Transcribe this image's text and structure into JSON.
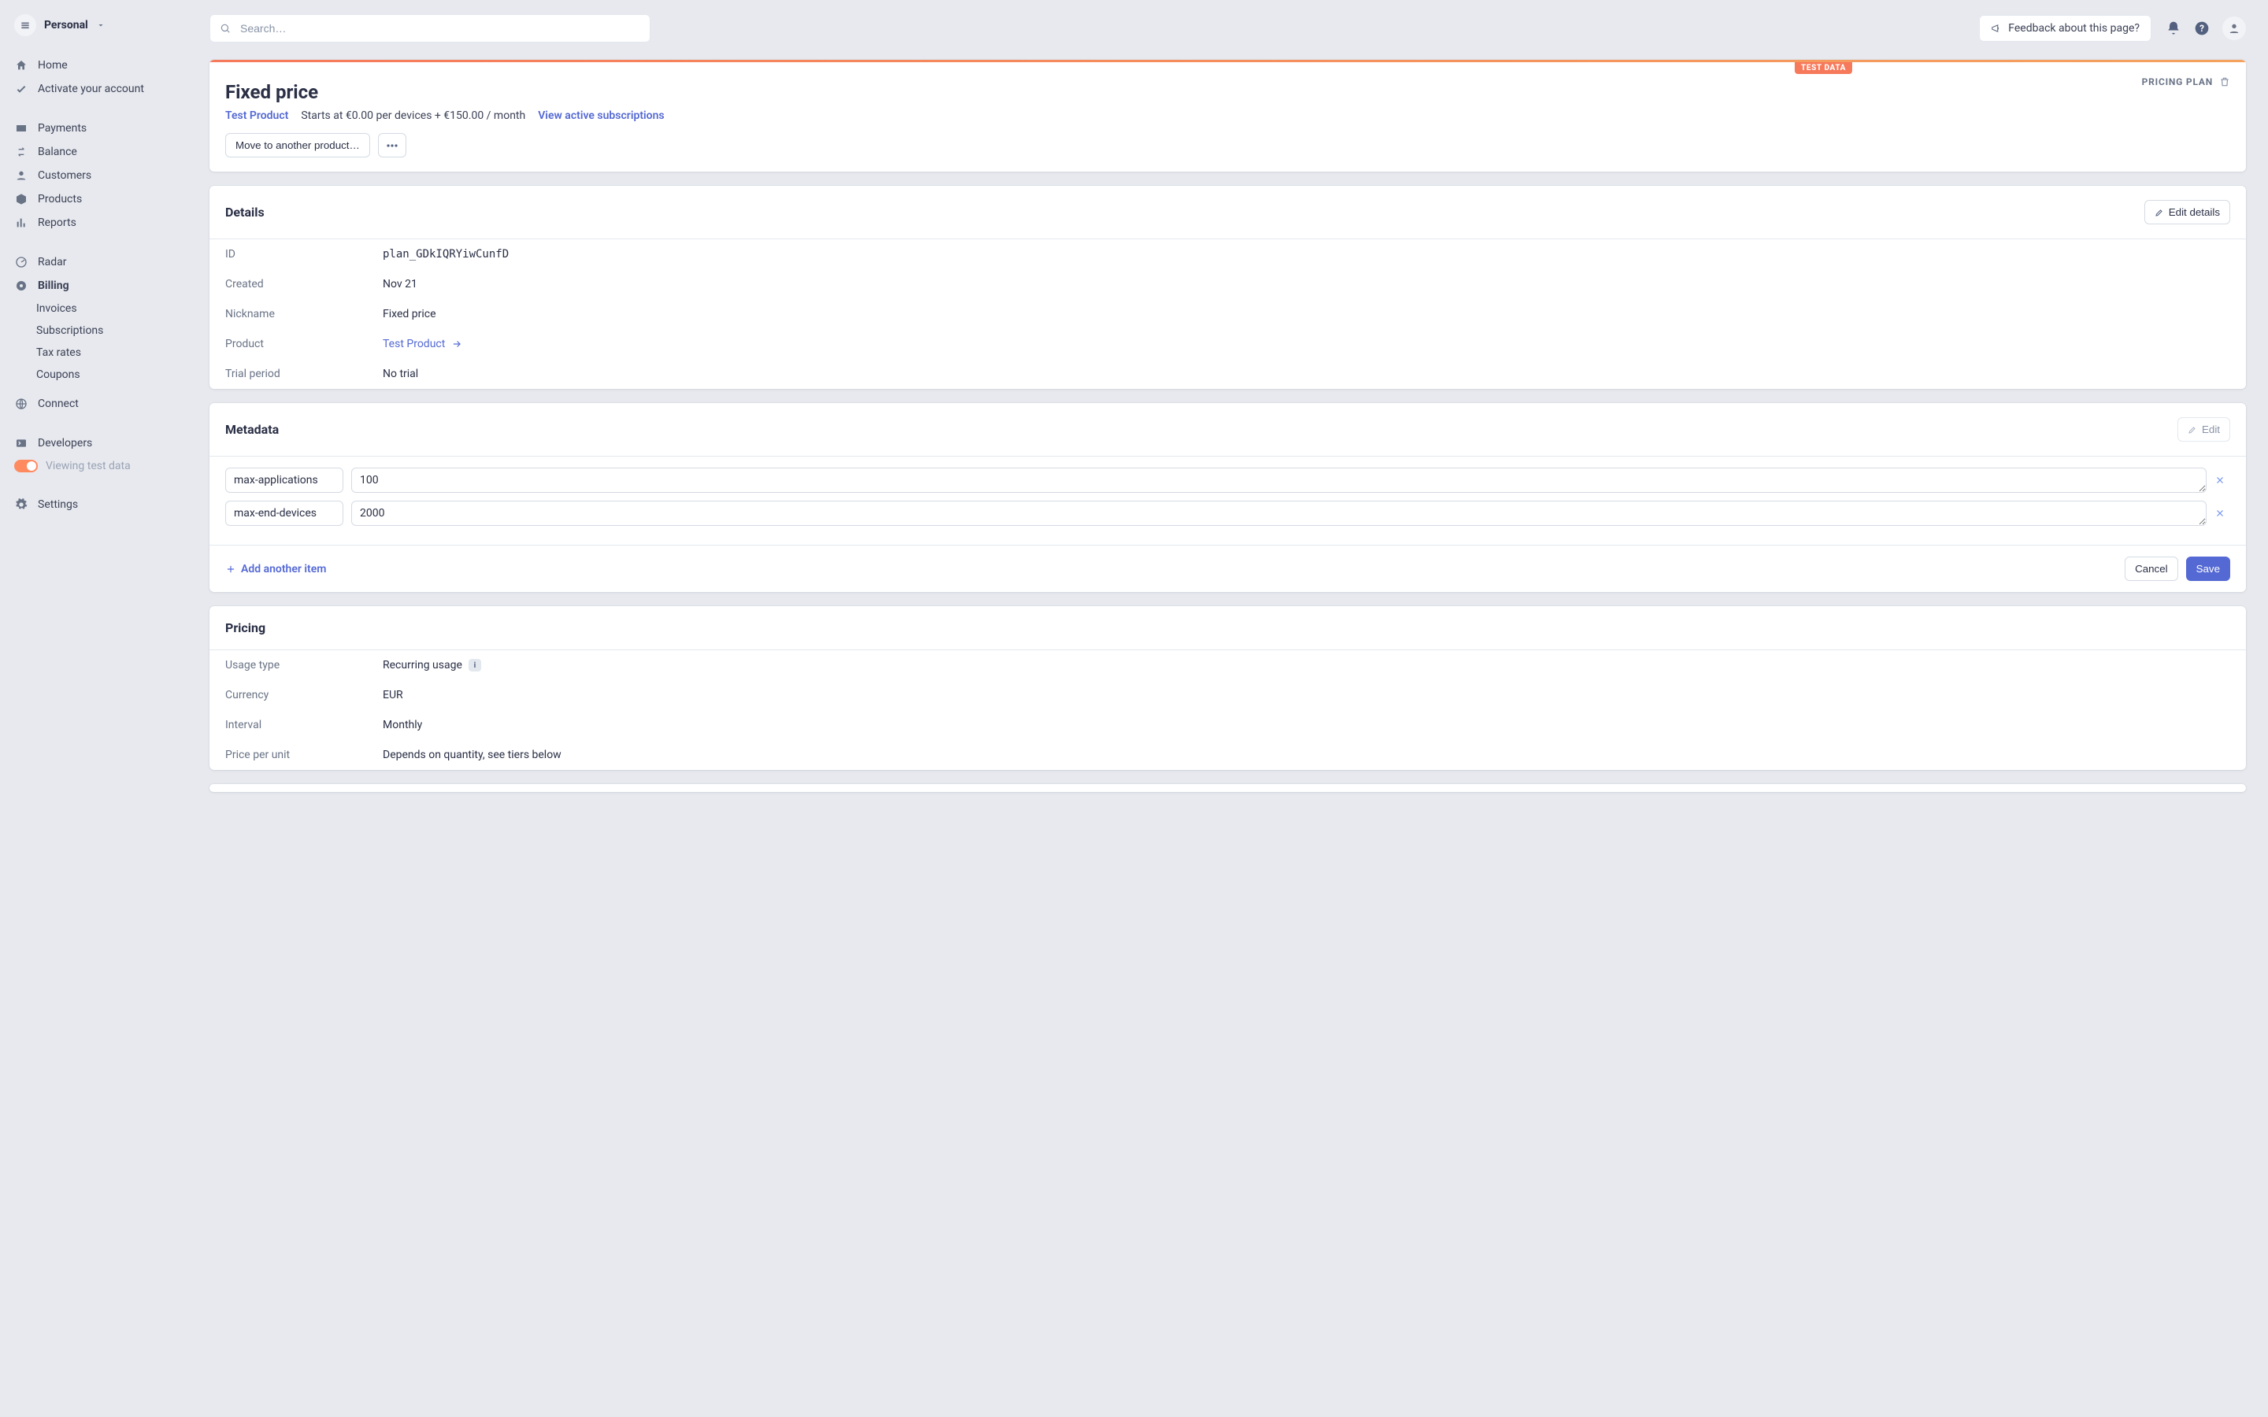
{
  "workspace": {
    "name": "Personal"
  },
  "search": {
    "placeholder": "Search…"
  },
  "feedback": {
    "label": "Feedback about this page?"
  },
  "nav": {
    "home": "Home",
    "activate": "Activate your account",
    "payments": "Payments",
    "balance": "Balance",
    "customers": "Customers",
    "products": "Products",
    "reports": "Reports",
    "radar": "Radar",
    "billing": "Billing",
    "invoices": "Invoices",
    "subscriptions": "Subscriptions",
    "taxrates": "Tax rates",
    "coupons": "Coupons",
    "connect": "Connect",
    "developers": "Developers",
    "testdata": "Viewing test data",
    "settings": "Settings"
  },
  "hero": {
    "badge": "TEST DATA",
    "title": "Fixed price",
    "plan_tag": "PRICING PLAN",
    "product_link": "Test Product",
    "price_text": "Starts at €0.00 per devices + €150.00 / month",
    "view_subs": "View active subscriptions",
    "move_btn": "Move to another product…"
  },
  "details": {
    "title": "Details",
    "edit_label": "Edit details",
    "rows": {
      "id_k": "ID",
      "id_v": "plan_GDkIQRYiwCunfD",
      "created_k": "Created",
      "created_v": "Nov 21",
      "nickname_k": "Nickname",
      "nickname_v": "Fixed price",
      "product_k": "Product",
      "product_v": "Test Product",
      "trial_k": "Trial period",
      "trial_v": "No trial"
    }
  },
  "metadata": {
    "title": "Metadata",
    "edit_label": "Edit",
    "rows": [
      {
        "key": "max-applications",
        "value": "100"
      },
      {
        "key": "max-end-devices",
        "value": "2000"
      }
    ],
    "add_label": "Add another item",
    "cancel": "Cancel",
    "save": "Save"
  },
  "pricing": {
    "title": "Pricing",
    "rows": {
      "usage_k": "Usage type",
      "usage_v": "Recurring usage",
      "currency_k": "Currency",
      "currency_v": "EUR",
      "interval_k": "Interval",
      "interval_v": "Monthly",
      "ppu_k": "Price per unit",
      "ppu_v": "Depends on quantity, see tiers below"
    }
  }
}
